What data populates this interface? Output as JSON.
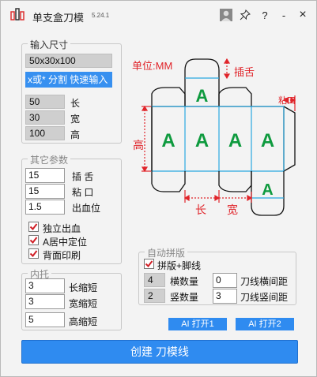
{
  "window": {
    "title": "单支盒刀模",
    "version": "5.24.1",
    "buttons": {
      "help": "?",
      "minimize": "-",
      "close": "×"
    }
  },
  "input_size": {
    "legend": "输入尺寸",
    "size_value": "50x30x100",
    "quick_input_label": "x或* 分割 快速输入",
    "length": {
      "value": "50",
      "label": "长"
    },
    "width": {
      "value": "30",
      "label": "宽"
    },
    "height": {
      "value": "100",
      "label": "高"
    }
  },
  "other_params": {
    "legend": "其它参数",
    "tuck": {
      "value": "15",
      "label": "插    舌"
    },
    "glue": {
      "value": "15",
      "label": "粘    口"
    },
    "bleed": {
      "value": "1.5",
      "label": "出血位"
    },
    "standalone_bleed": {
      "label": "独立出血",
      "checked": true
    },
    "center_a": {
      "label": "A居中定位",
      "checked": true
    },
    "back_print": {
      "label": "背面印刷",
      "checked": true
    }
  },
  "inner_tray": {
    "legend": "内托",
    "length_shrink": {
      "value": "3",
      "label": "长缩短"
    },
    "width_shrink": {
      "value": "3",
      "label": "宽缩短"
    },
    "height_shrink": {
      "value": "5",
      "label": "高缩短"
    }
  },
  "auto_layout": {
    "legend": "自动拼版",
    "imposition": {
      "label": "拼版+脚线",
      "checked": true
    },
    "h_count": {
      "value": "4",
      "label": "横数量"
    },
    "v_count": {
      "value": "2",
      "label": "竖数量"
    },
    "h_gap": {
      "value": "0",
      "label": "刀线横间距"
    },
    "v_gap": {
      "value": "3",
      "label": "刀线竖间距"
    }
  },
  "diagram": {
    "unit_label": "单位:MM",
    "tuck_label": "插舌",
    "glue_label": "粘口",
    "height_label": "高",
    "length_label": "长",
    "width_label": "宽",
    "panel_letter": "A",
    "colors": {
      "red": "#e0242a",
      "green": "#0e9a3e",
      "panel_line": "#29a8e0"
    }
  },
  "actions": {
    "open1": "AI   打开1",
    "open2": "AI   打开2",
    "create": "创建 刀模线"
  }
}
